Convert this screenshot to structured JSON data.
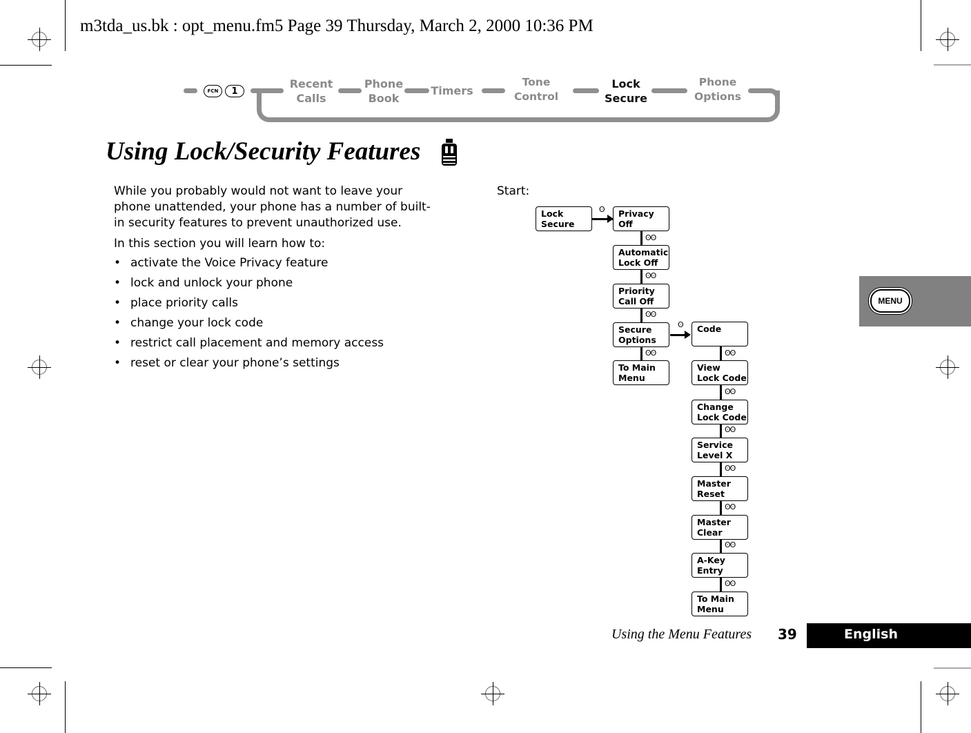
{
  "print_header": "m3tda_us.bk : opt_menu.fm5  Page 39  Thursday, March 2, 2000  10:36 PM",
  "nav_strip": {
    "keys": [
      "FCN",
      "1"
    ],
    "items": [
      {
        "label": "Recent\nCalls",
        "active": false
      },
      {
        "label": "Phone\nBook",
        "active": false
      },
      {
        "label": "Timers",
        "active": false
      },
      {
        "label": "Tone\nControl",
        "active": false
      },
      {
        "label": "Lock\nSecure",
        "active": true
      },
      {
        "label": "Phone\nOptions",
        "active": false
      }
    ]
  },
  "page_title": "Using Lock/Security Features",
  "title_icon": "lock-icon",
  "intro": "While you probably would not want to leave your phone unattended, your phone has a number of built-in security features to prevent unauthorized use.",
  "learn_heading": "In this section you will learn how to:",
  "bullets": [
    "activate the Voice Privacy feature",
    "lock and unlock your phone",
    "place priority calls",
    "change your lock code",
    "restrict call placement and memory access",
    "reset or clear your phone’s settings"
  ],
  "diagram": {
    "start_label": "Start:",
    "start_box": "Lock\nSecure",
    "select_key_glyph": "ʘ",
    "scroll_glyph": "ʘʘ",
    "main_column": [
      "Privacy\nOff",
      "Automatic\nLock Off",
      "Priority\nCall Off",
      "Secure\nOptions",
      "To Main\nMenu"
    ],
    "sub_column": [
      "Code",
      "View\nLock Code",
      "Change\nLock Code",
      "Service\nLevel X",
      "Master\nReset",
      "Master\nClear",
      "A-Key\nEntry",
      "To Main\nMenu"
    ]
  },
  "side_tab": {
    "label": "MENU"
  },
  "footer": {
    "section": "Using the Menu Features",
    "page_number": "39",
    "language": "English"
  },
  "colors": {
    "nav_inactive": "#8a8a8a",
    "nav_bar": "#8f8f8f",
    "side_tab": "#818181",
    "lang_tab": "#000000"
  }
}
